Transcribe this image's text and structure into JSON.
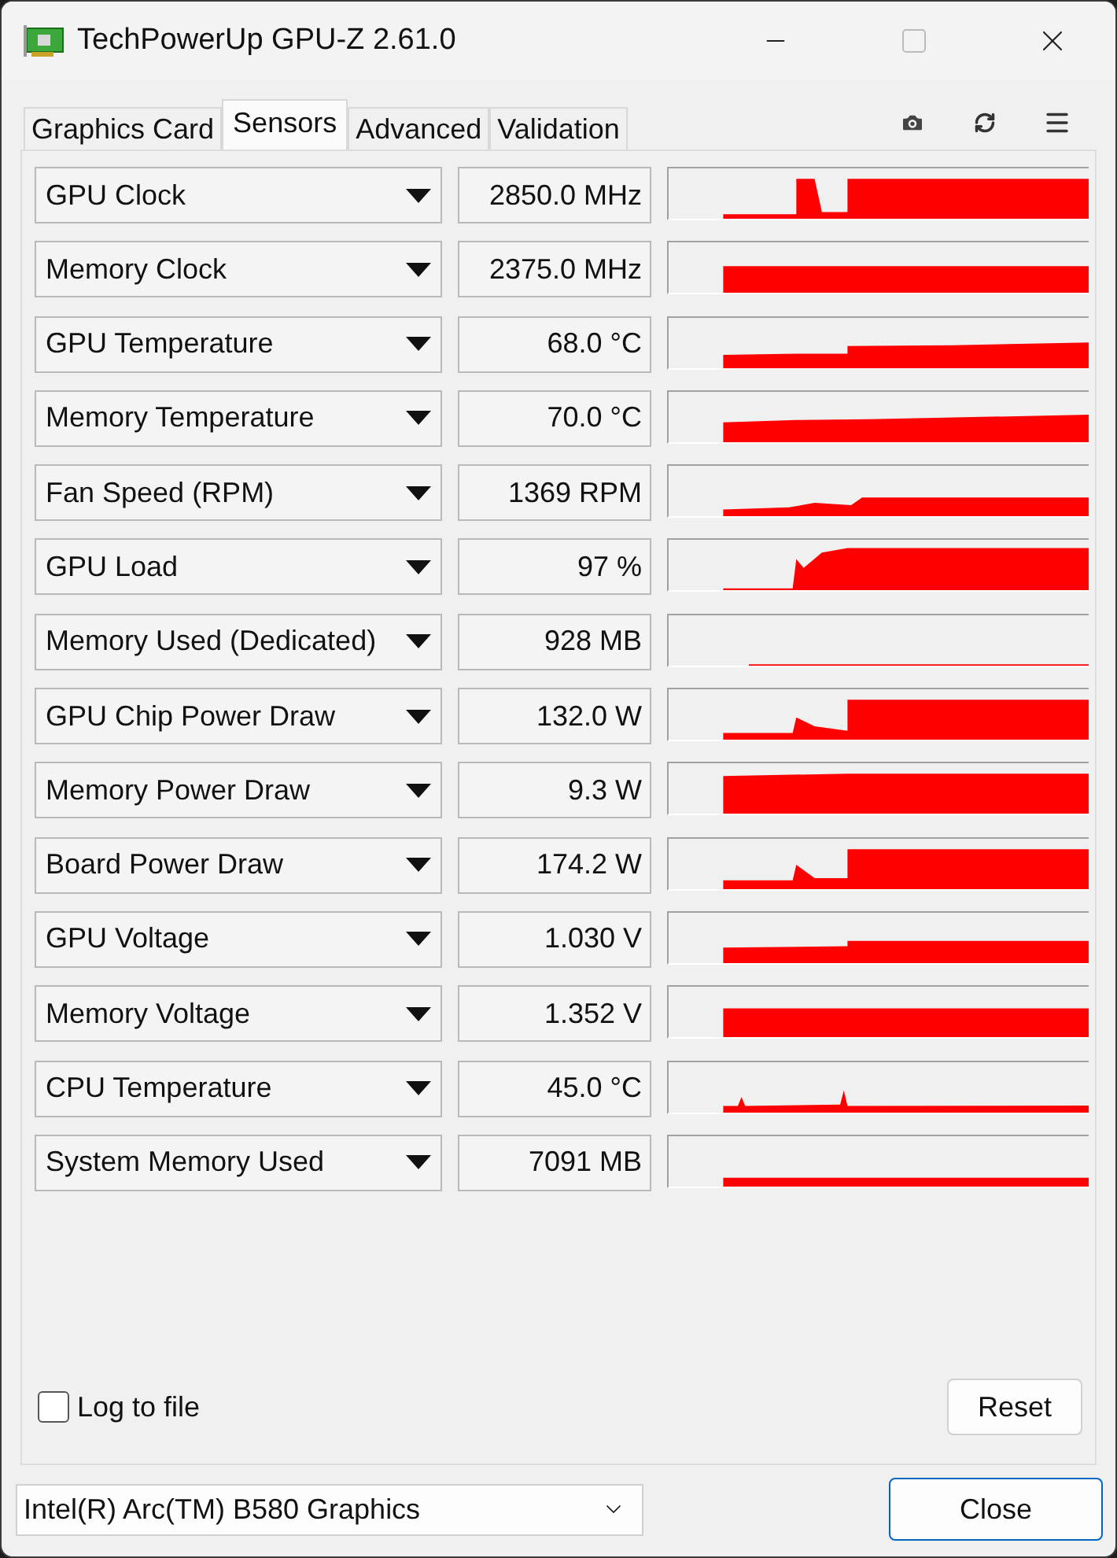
{
  "window": {
    "title": "TechPowerUp GPU-Z 2.61.0"
  },
  "tabs": [
    {
      "label": "Graphics Card",
      "selected": false
    },
    {
      "label": "Sensors",
      "selected": true
    },
    {
      "label": "Advanced",
      "selected": false
    },
    {
      "label": "Validation",
      "selected": false
    }
  ],
  "sensors": [
    {
      "name": "GPU Clock",
      "value": "2850.0 MHz"
    },
    {
      "name": "Memory Clock",
      "value": "2375.0 MHz"
    },
    {
      "name": "GPU Temperature",
      "value": "68.0 °C"
    },
    {
      "name": "Memory Temperature",
      "value": "70.0 °C"
    },
    {
      "name": "Fan Speed (RPM)",
      "value": "1369 RPM"
    },
    {
      "name": "GPU Load",
      "value": "97 %"
    },
    {
      "name": "Memory Used (Dedicated)",
      "value": "928 MB"
    },
    {
      "name": "GPU Chip Power Draw",
      "value": "132.0 W"
    },
    {
      "name": "Memory Power Draw",
      "value": "9.3 W"
    },
    {
      "name": "Board Power Draw",
      "value": "174.2 W"
    },
    {
      "name": "GPU Voltage",
      "value": "1.030 V"
    },
    {
      "name": "Memory Voltage",
      "value": "1.352 V"
    },
    {
      "name": "CPU Temperature",
      "value": "45.0 °C"
    },
    {
      "name": "System Memory Used",
      "value": "7091 MB"
    }
  ],
  "log_to_file": {
    "label": "Log to file",
    "checked": false
  },
  "reset_button": "Reset",
  "device_select": {
    "value": "Intel(R) Arc(TM) B580 Graphics"
  },
  "close_button": "Close"
}
